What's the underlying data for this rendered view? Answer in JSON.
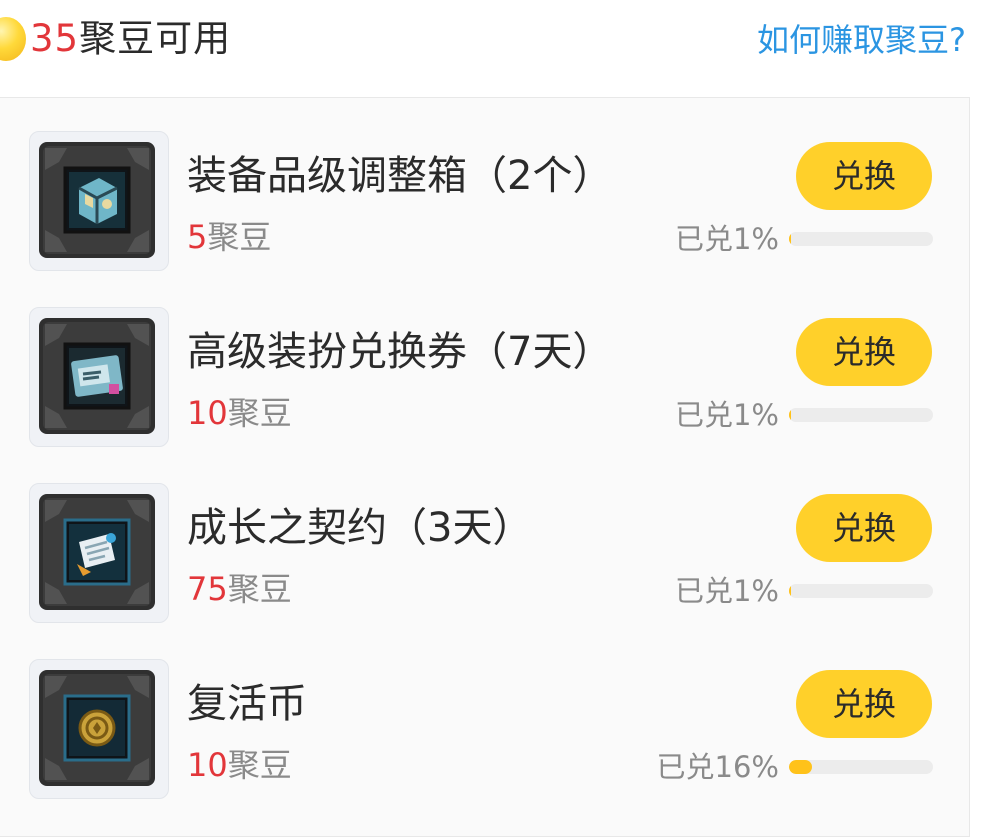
{
  "header": {
    "balance_value": "35",
    "balance_label": "聚豆可用",
    "earn_link": "如何赚取聚豆?"
  },
  "items": [
    {
      "icon": "equipment-box-icon",
      "name": "装备品级调整箱（2个）",
      "price": "5",
      "price_unit": "聚豆",
      "button": "兑换",
      "progress_label": "已兑1%",
      "progress": 0.01
    },
    {
      "icon": "avatar-voucher-icon",
      "name": "高级装扮兑换券（7天）",
      "price": "10",
      "price_unit": "聚豆",
      "button": "兑换",
      "progress_label": "已兑1%",
      "progress": 0.01
    },
    {
      "icon": "contract-scroll-icon",
      "name": "成长之契约（3天）",
      "price": "75",
      "price_unit": "聚豆",
      "button": "兑换",
      "progress_label": "已兑1%",
      "progress": 0.01
    },
    {
      "icon": "revival-coin-icon",
      "name": "复活币",
      "price": "10",
      "price_unit": "聚豆",
      "button": "兑换",
      "progress_label": "已兑16%",
      "progress": 0.16
    }
  ],
  "colors": {
    "accent_red": "#e2363a",
    "button_yellow": "#ffd02a",
    "link_blue": "#2b95e2",
    "progress_fill": "#ffc21a"
  }
}
